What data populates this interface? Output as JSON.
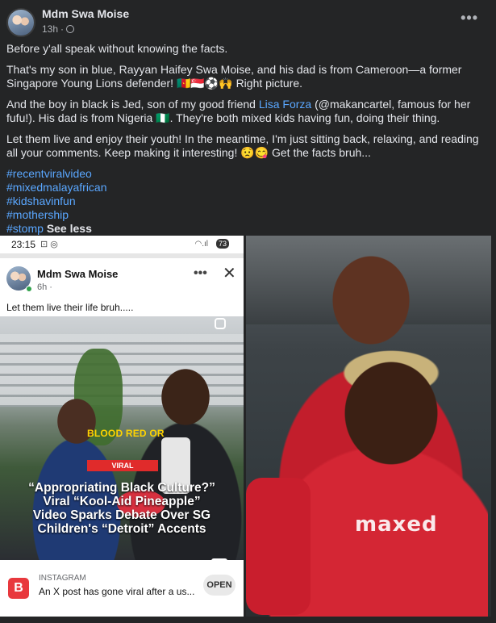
{
  "post": {
    "author": "Mdm Swa Moise",
    "time": "13h",
    "more_icon": "more-horizontal-icon",
    "paragraphs": {
      "p1": "Before y'all speak without knowing the facts.",
      "p2": "That's my son in blue, Rayyan Haifey Swa Moise, and his dad is from Cameroon—a former Singapore Young Lions defender! 🇨🇲🇸🇬⚽🙌 Right picture.",
      "p3_pre": "And the boy in black is Jed, son of my good friend ",
      "p3_link": "Lisa Forza",
      "p3_post": "  (@makancartel, famous for her fufu!). His dad is from Nigeria 🇳🇬. They're both mixed kids having fun, doing their thing.",
      "p4": "Let them live and enjoy their youth! In the meantime, I'm just sitting back, relaxing, and reading all your comments. Keep making it interesting! 😟😋 Get the facts bruh..."
    },
    "hashtags": [
      "#recentviralvideo",
      "#mixedmalayafrican",
      "#kidshavinfun",
      "#mothership",
      "#stomp"
    ],
    "see_less": "See less"
  },
  "phone_screenshot": {
    "status_time": "23:15",
    "battery": "73",
    "author": "Mdm Swa Moise",
    "time": "6h ·",
    "text": "Let them live their life bruh.....",
    "image": {
      "overlay_text": "BLOOD RED OR",
      "badge": "VIRAL",
      "headline_line1": "“Appropriating Black Culture?”",
      "headline_line2": "Viral “Kool-Aid Pineapple”",
      "headline_line3": "Video Sparks Debate Over SG",
      "headline_line4": "Children's “Detroit” Accents"
    },
    "link_preview": {
      "source": "INSTAGRAM",
      "title": "An X post has gone viral after a us...",
      "button": "OPEN",
      "logo": "B"
    }
  },
  "photo": {
    "sponsor_text": "maxed"
  }
}
